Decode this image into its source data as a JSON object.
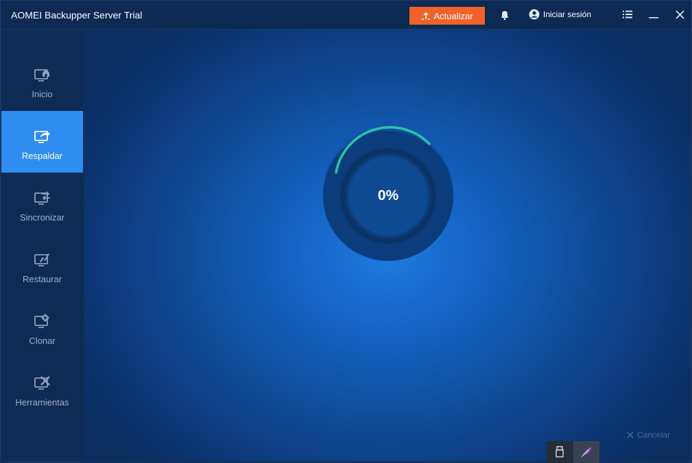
{
  "window": {
    "title": "AOMEI Backupper Server Trial"
  },
  "header": {
    "upgrade_label": "Actualizar",
    "login_label": "Iniciar sesión"
  },
  "sidebar": {
    "items": [
      {
        "label": "Inicio",
        "icon": "home-monitor-icon",
        "active": false
      },
      {
        "label": "Respaldar",
        "icon": "backup-monitor-icon",
        "active": true
      },
      {
        "label": "Sincronizar",
        "icon": "sync-monitor-icon",
        "active": false
      },
      {
        "label": "Restaurar",
        "icon": "restore-monitor-icon",
        "active": false
      },
      {
        "label": "Clonar",
        "icon": "clone-monitor-icon",
        "active": false
      },
      {
        "label": "Herramientas",
        "icon": "tools-monitor-icon",
        "active": false
      }
    ]
  },
  "main": {
    "progress_label": "0%",
    "progress_value": 0,
    "cancel_label": "Cancelar"
  },
  "colors": {
    "accent": "#2f8df2",
    "upgrade": "#f0622a",
    "progress_arc": "#2ec9a8"
  }
}
